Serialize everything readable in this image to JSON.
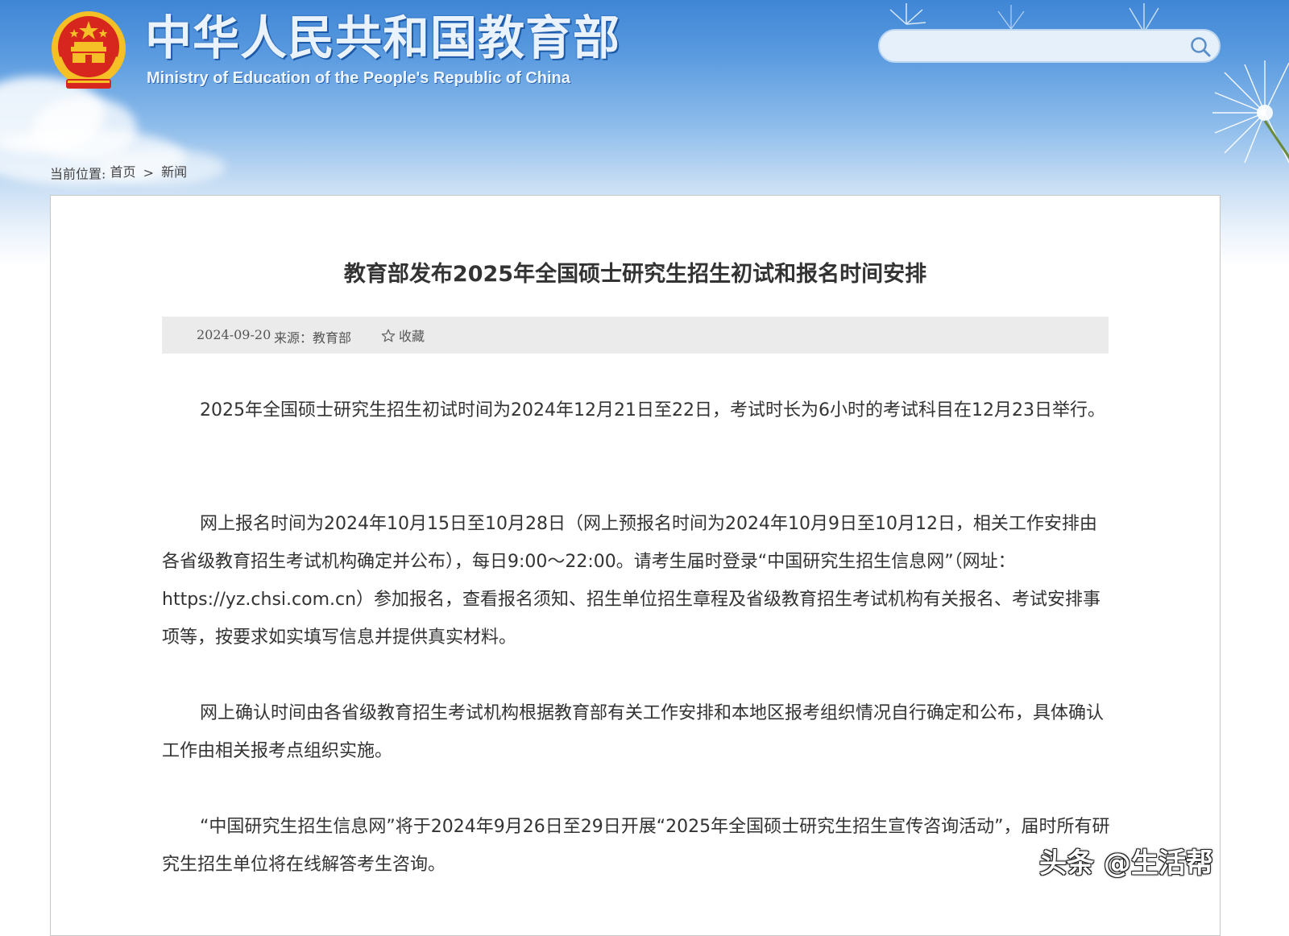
{
  "header": {
    "site_title": "中华人民共和国教育部",
    "site_subtitle": "Ministry of Education of the People's Republic of China",
    "search": {
      "value": "",
      "placeholder": ""
    }
  },
  "breadcrumb": {
    "prefix": "当前位置:",
    "items": [
      "首页",
      "新闻"
    ],
    "separator": ">"
  },
  "article": {
    "title": "教育部发布2025年全国硕士研究生招生初试和报名时间安排",
    "meta": {
      "date": "2024-09-20",
      "source": "来源：教育部",
      "favorite": "收藏"
    },
    "paragraphs": [
      "2025年全国硕士研究生招生初试时间为2024年12月21日至22日，考试时长为6小时的考试科目在12月23日举行。",
      "网上报名时间为2024年10月15日至10月28日（网上预报名时间为2024年10月9日至10月12日，相关工作安排由各省级教育招生考试机构确定并公布），每日9:00～22:00。请考生届时登录“中国研究生招生信息网”（网址：https://yz.chsi.com.cn）参加报名，查看报名须知、招生单位招生章程及省级教育招生考试机构有关报名、考试安排事项等，按要求如实填写信息并提供真实材料。",
      "网上确认时间由各省级教育招生考试机构根据教育部有关工作安排和本地区报考组织情况自行确定和公布，具体确认工作由相关报考点组织实施。",
      "“中国研究生招生信息网”将于2024年9月26日至29日开展“2025年全国硕士研究生招生宣传咨询活动”，届时所有研究生招生单位将在线解答考生咨询。"
    ]
  },
  "watermark": "头条 @生活帮",
  "colors": {
    "banner_top": "#3f86d6",
    "emblem_red": "#d6261d",
    "emblem_gold": "#f5c026",
    "text": "#333333",
    "meta_bg": "#ebebeb"
  }
}
